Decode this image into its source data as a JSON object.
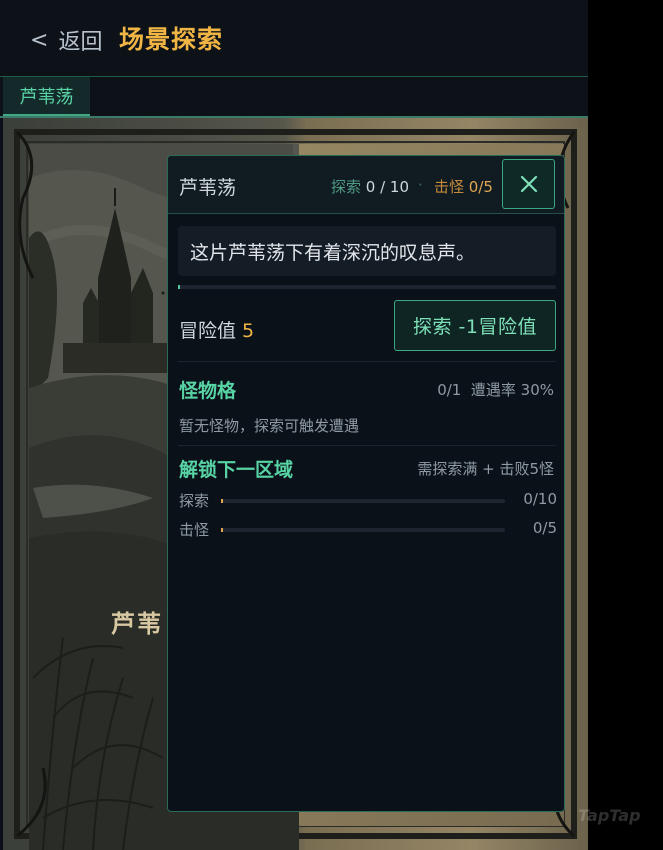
{
  "header": {
    "back_label": "返回",
    "title": "场景探索"
  },
  "tabs": [
    {
      "label": "芦苇荡",
      "active": true
    }
  ],
  "scene": {
    "map_label": "芦苇"
  },
  "panel": {
    "title": "芦苇荡",
    "explore_label": "探索",
    "explore_value": "0 / 10",
    "separator": "·",
    "kill_label": "击怪",
    "kill_value": "0/5",
    "description": "这片芦苇荡下有着深沉的叹息声。",
    "explore_progress": 0.0,
    "risk_label": "冒险值",
    "risk_value": "5",
    "explore_button": "探索  -1冒险值",
    "monster_section": {
      "title": "怪物格",
      "count": "0/1",
      "encounter": "遭遇率 30%",
      "empty_text": "暂无怪物，探索可触发遭遇"
    },
    "unlock_section": {
      "title": "解锁下一区域",
      "requirement": "需探索满 + 击败5怪",
      "rows": [
        {
          "label": "探索",
          "value": "0/10",
          "progress": 0.0
        },
        {
          "label": "击怪",
          "value": "0/5",
          "progress": 0.0
        }
      ]
    }
  },
  "colors": {
    "accent": "#58d3a4",
    "gold": "#f0b545",
    "panel_bg": "#0a1119",
    "border": "#2a6b58"
  },
  "watermark": "TapTap"
}
